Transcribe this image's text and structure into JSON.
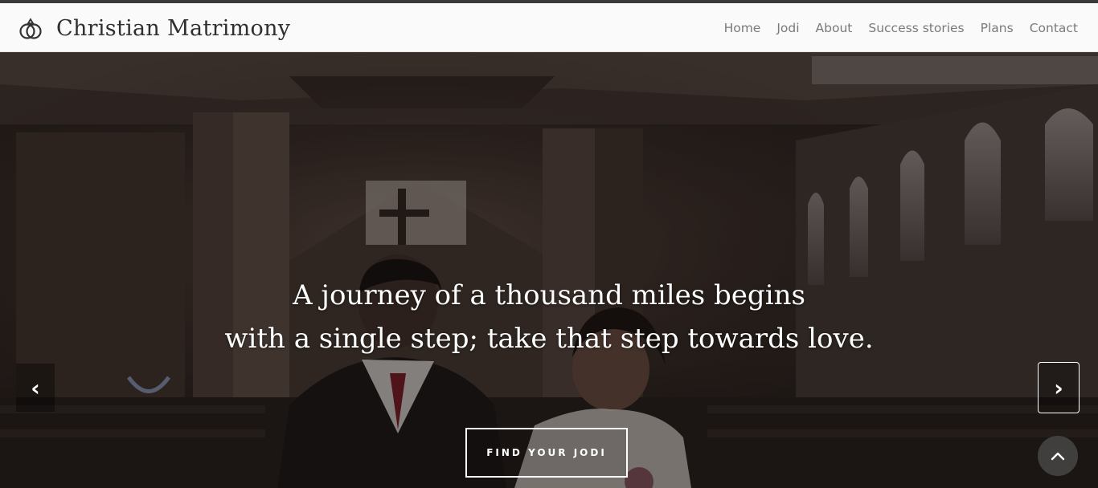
{
  "header": {
    "brand": "Christian Matrimony",
    "logo_icon": "rings-icon"
  },
  "nav": {
    "items": [
      "Home",
      "Jodi",
      "About",
      "Success stories",
      "Plans",
      "Contact"
    ]
  },
  "hero": {
    "caption_line1": "A journey of a thousand miles begins",
    "caption_line2": "with a single step; take that step towards love.",
    "cta_label": "FIND YOUR JODI",
    "prev_icon": "chevron-left-icon",
    "prev_glyph": "‹",
    "next_icon": "chevron-right-icon",
    "next_glyph": "›",
    "scroll_top_icon": "chevron-up-icon"
  },
  "colors": {
    "navbar_bg": "#fafafa",
    "brand_text": "#2f2f2f",
    "nav_text": "#7a7a7a",
    "caption_text": "#ffffff"
  }
}
